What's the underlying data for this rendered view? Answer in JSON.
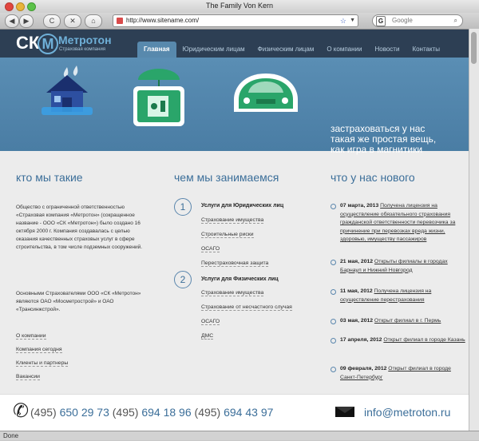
{
  "window": {
    "title": "The Family Von Kern"
  },
  "browser": {
    "back": "◀",
    "forward": "▶",
    "reload": "C",
    "stop": "✕",
    "home": "⌂",
    "url": "http://www.sitename.com/",
    "search_placeholder": "Google",
    "status": "Done"
  },
  "site": {
    "logo_mark": "СК",
    "logo_letter": "М",
    "logo_name": "Метротон",
    "logo_sub": "Страховая компания",
    "nav": [
      "Главная",
      "Юридическим лицам",
      "Физическим лицам",
      "О компании",
      "Новости",
      "Контакты"
    ],
    "hero": [
      "застраховаться у нас",
      "такая же простая вещь,",
      "как игра в магнитики"
    ]
  },
  "about": {
    "heading": "кто мы такие",
    "p1": "Общество с ограниченной ответственностью «Страховая компания «Метротон» (сокращенное название - ООО «СК «Метротон») было создано 16 октября 2000 г. Компания создавалась с целью оказания качественных страховых услуг в сфере строительства, в том числе подземных сооружений.",
    "p2": "Основными Страхователями ООО «СК «Метротон» являются ОАО «Мосметрострой» и ОАО «Трансинжстрой».",
    "links": [
      "О компании",
      "Компания сегодня",
      "Клиенты и партнеры",
      "Вакансии"
    ]
  },
  "services": {
    "heading": "чем мы занимаемся",
    "groups": [
      {
        "num": "1",
        "title": "Услуги для Юридических лиц",
        "items": [
          "Страхование имущества",
          "Строительные риски",
          "ОСАГО",
          "Перестраховочная защита"
        ]
      },
      {
        "num": "2",
        "title": "Услуги для Физических лиц",
        "items": [
          "Страхование имущества",
          "Страхование от несчастного случая",
          "ОСАГО",
          "ДМС"
        ]
      }
    ]
  },
  "news": {
    "heading": "что у нас нового",
    "items": [
      {
        "date": "07 марта, 2013",
        "text": "Получена лицензия на осуществление обязательного страхования гражданской ответственности перевозчика за причинение при перевозках вреда жизни, здоровью, имуществу пассажиров"
      },
      {
        "date": "21 мая, 2012",
        "text": "Открыты филиалы в городах Барнаул и Нижний Новгород"
      },
      {
        "date": "11 мая, 2012",
        "text": "Получена лицензия на осуществление перестрахования"
      },
      {
        "date": "03 мая, 2012",
        "text": "Открыт филиал в г. Пермь"
      },
      {
        "date": "17 апреля, 2012",
        "text": "Открыт филиал в городе Казань"
      },
      {
        "date": "09 февраля, 2012",
        "text": "Открыт филиал в городе Санкт-Петербург"
      }
    ]
  },
  "footer": {
    "phone_code": "(495)",
    "phones": [
      "650 29 73",
      "694 18 96",
      "694 43 97"
    ],
    "email": "info@metroton.ru"
  },
  "colors": {
    "accent": "#3b6e99",
    "header": "#2d3f54",
    "hero": "#5a8eb4",
    "green": "#2aa56a"
  }
}
